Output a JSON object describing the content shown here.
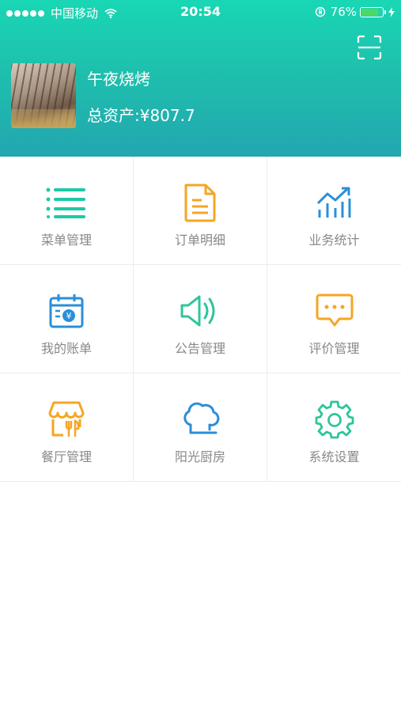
{
  "status_bar": {
    "carrier": "中国移动",
    "time": "20:54",
    "battery": "76%"
  },
  "header": {
    "shop_name": "午夜烧烤",
    "total_assets": "总资产:¥807.7"
  },
  "menu": {
    "items": [
      {
        "label": "菜单管理",
        "icon": "list-icon"
      },
      {
        "label": "订单明细",
        "icon": "document-icon"
      },
      {
        "label": "业务统计",
        "icon": "chart-icon"
      },
      {
        "label": "我的账单",
        "icon": "bill-icon"
      },
      {
        "label": "公告管理",
        "icon": "speaker-icon"
      },
      {
        "label": "评价管理",
        "icon": "comment-icon"
      },
      {
        "label": "餐厅管理",
        "icon": "restaurant-icon"
      },
      {
        "label": "阳光厨房",
        "icon": "chef-hat-icon"
      },
      {
        "label": "系统设置",
        "icon": "gear-icon"
      }
    ]
  },
  "colors": {
    "teal": "#1dc9a6",
    "orange": "#f5a623",
    "blue": "#2a8fd8",
    "green": "#2ec59a"
  }
}
